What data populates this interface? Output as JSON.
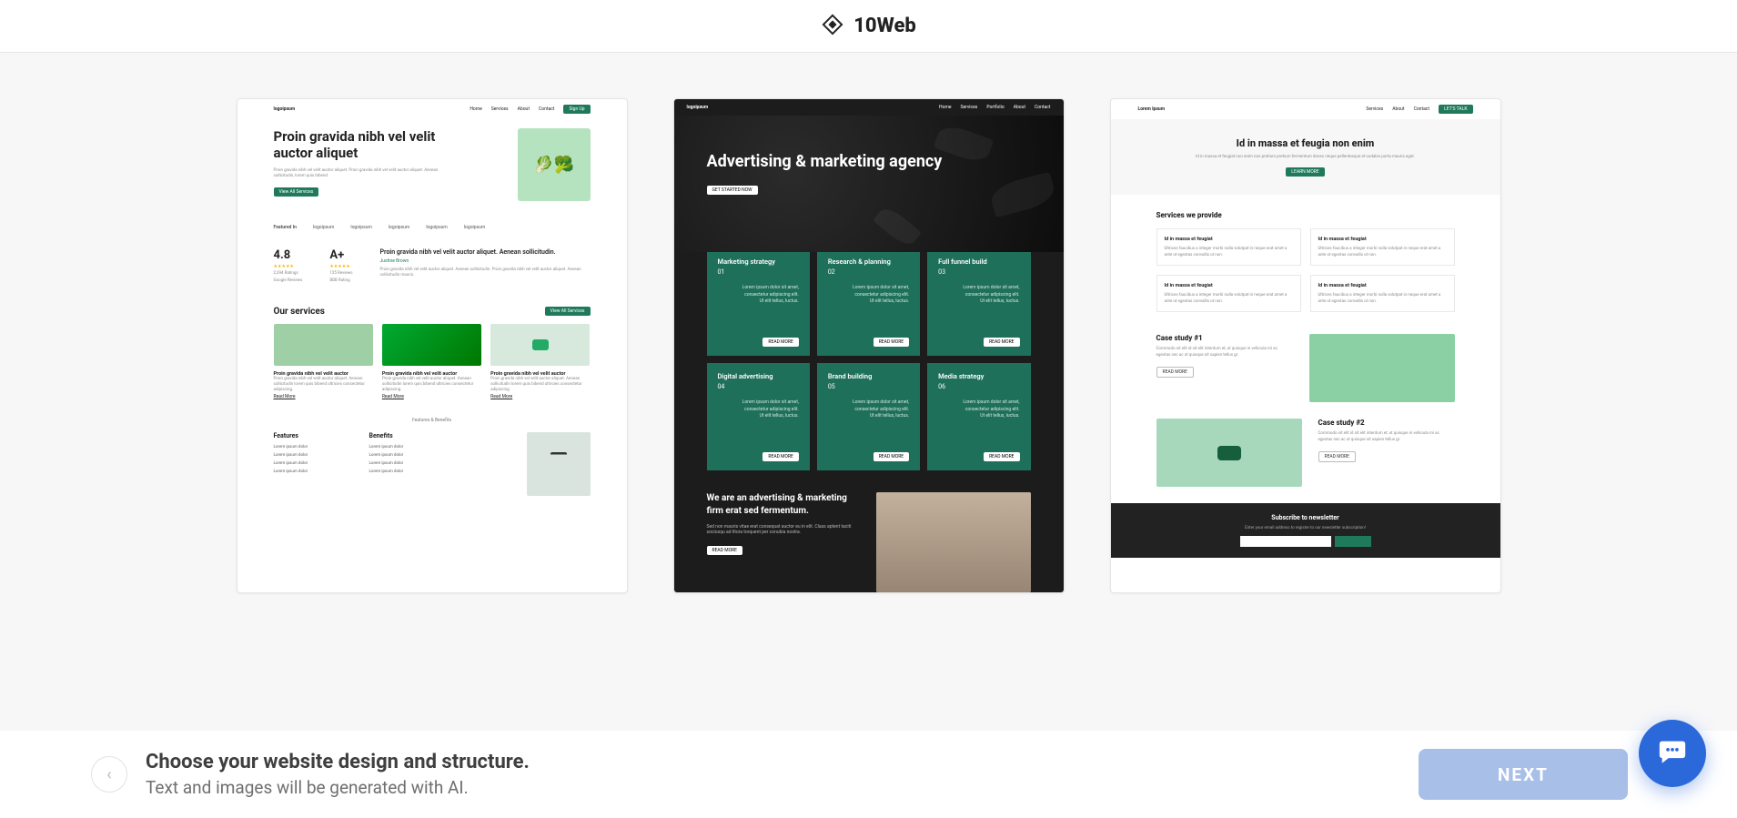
{
  "brand": "10Web",
  "footer": {
    "heading": "Choose your website design and structure.",
    "sub": "Text and images will be generated with AI.",
    "next": "NEXT"
  },
  "t1": {
    "logo": "logoipsum",
    "nav": [
      "Home",
      "Services",
      "About",
      "Contact"
    ],
    "sign_up": "Sign Up",
    "hero_title": "Proin gravida nibh vel velit auctor aliquet",
    "hero_sub": "Proin gravida nibh vel velit auctor aliquet. Proin gravida nibh vel velit auctor aliquet. Aenean sollicitudin, lorem quis bibend.",
    "hero_cta": "View All Services",
    "featured_label": "Featured In",
    "featured": [
      "logoipsum",
      "logoipsum",
      "logoipsum",
      "logoipsum",
      "logoipsum"
    ],
    "rating_score": "4.8",
    "rating_count": "2,394 Ratings",
    "rating_source": "Google Reviews",
    "grade": "A+",
    "grade_sub": "125 Reviews",
    "grade_source": "BBB Rating",
    "rating_headline": "Proin gravida nibh vel velit auctor aliquet. Aenean sollicitudin.",
    "rating_name": "Justine Brown",
    "rating_body": "Proin gravida nibh vel velit auctor aliquet. Aenean sollicitudin. Proin gravida nibh vel velit auctor aliquet. Aenean sollicitudin mauris.",
    "services_title": "Our services",
    "services_cta": "View All Services",
    "services": [
      {
        "title": "Proin gravida nibh vel velit auctor",
        "body": "Proin gravida nibh vel velit auctor aliquet. Aenean sollicitudin lorem quis bibend ultricies consectetur adipiscing.",
        "link": "Read More"
      },
      {
        "title": "Proin gravida nibh vel velit auctor",
        "body": "Proin gravida nibh vel velit auctor aliquet. Aenean sollicitudin lorem quis bibend ultricies consectetur adipiscing.",
        "link": "Read More"
      },
      {
        "title": "Proin gravida nibh vel velit auctor",
        "body": "Proin gravida nibh vel velit auctor aliquet. Aenean sollicitudin lorem quis bibend ultricies consectetur adipiscing.",
        "link": "Read More"
      }
    ],
    "fb_label": "Features & Benefits",
    "features_title": "Features",
    "benefits_title": "Benefits",
    "features": [
      "Lorem ipsum dolor",
      "Lorem ipsum dolor",
      "Lorem ipsum dolor",
      "Lorem ipsum dolor"
    ],
    "benefits": [
      "Lorem ipsum dolor",
      "Lorem ipsum dolor",
      "Lorem ipsum dolor",
      "Lorem ipsum dolor"
    ]
  },
  "t2": {
    "logo": "logoipsum",
    "nav": [
      "Home",
      "Services",
      "Portfolio",
      "About",
      "Contact"
    ],
    "hero_title": "Advertising & marketing agency",
    "hero_cta": "GET STARTED NOW",
    "card_body": "Lorem ipsum dolor sit amet, consectetur adipiscing elit. Ut elit tellus, luctus.",
    "read_more": "READ MORE",
    "cards": [
      {
        "title": "Marketing strategy",
        "num": "01"
      },
      {
        "title": "Research & planning",
        "num": "02"
      },
      {
        "title": "Full funnel build",
        "num": "03"
      },
      {
        "title": "Digital advertising",
        "num": "04"
      },
      {
        "title": "Brand building",
        "num": "05"
      },
      {
        "title": "Media strategy",
        "num": "06"
      }
    ],
    "about_title": "We are an advertising & marketing firm erat sed fermentum.",
    "about_body": "Sed non mauris vitae erat consequat auctor eu in elit. Class aptent taciti sociosqu ad litora torquent per conubia nostra.",
    "about_cta": "READ MORE"
  },
  "t3": {
    "logo": "Lorem Ipsum",
    "nav": [
      "Services",
      "About",
      "Contact"
    ],
    "cta": "LET'S TALK",
    "hero_title": "Id in massa et feugia non enim",
    "hero_sub": "Id in massa et feugiat non enim non pretium pretium fermentum donec neque pellentesque et sodales porta mauris eget.",
    "hero_cta": "LEARN MORE",
    "services_title": "Services we provide",
    "service_item_title": "Id in massa et feugiat",
    "service_item_body": "Ultrices faucibus a integer morbi nulla volutpat in neque erat amet a ante ut egestas convallis ut non.",
    "cs1_title": "Case study #1",
    "cs2_title": "Case study #2",
    "cs_body": "Commodo sit elit id sit elit interdum et, ut quisque in vehicula mi ac egestas nec ac ut quisque sit sapien tellus gr.",
    "cs_cta": "READ MORE",
    "news_title": "Subscribe to newsletter",
    "news_sub": "Enter your email address to register to our newsletter subscription!"
  }
}
